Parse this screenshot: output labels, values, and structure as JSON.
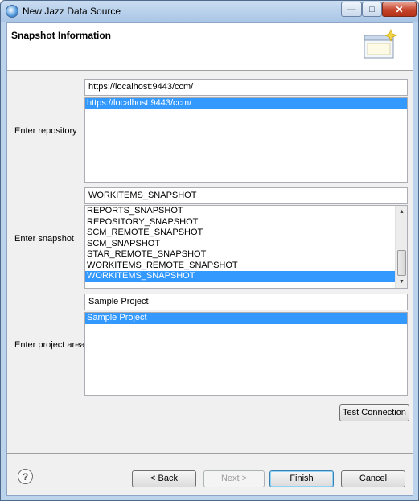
{
  "window": {
    "title": "New Jazz Data Source"
  },
  "header": {
    "title": "Snapshot Information"
  },
  "repository": {
    "label": "Enter repository",
    "value": "https://localhost:9443/ccm/",
    "items": [
      "https://localhost:9443/ccm/"
    ],
    "selected_index": 0
  },
  "snapshot": {
    "label": "Enter snapshot",
    "value": "WORKITEMS_SNAPSHOT",
    "items": [
      "REPORTS_SNAPSHOT",
      "REPOSITORY_SNAPSHOT",
      "SCM_REMOTE_SNAPSHOT",
      "SCM_SNAPSHOT",
      "STAR_REMOTE_SNAPSHOT",
      "WORKITEMS_REMOTE_SNAPSHOT",
      "WORKITEMS_SNAPSHOT"
    ],
    "selected_index": 6
  },
  "project": {
    "label": "Enter project area",
    "value": "Sample Project",
    "items": [
      "Sample Project"
    ],
    "selected_index": 0
  },
  "buttons": {
    "test_connection": "Test Connection",
    "back": "< Back",
    "next": "Next >",
    "finish": "Finish",
    "cancel": "Cancel"
  },
  "icons": {
    "help": "?",
    "minimize": "—",
    "maximize": "□",
    "close": "✕"
  }
}
